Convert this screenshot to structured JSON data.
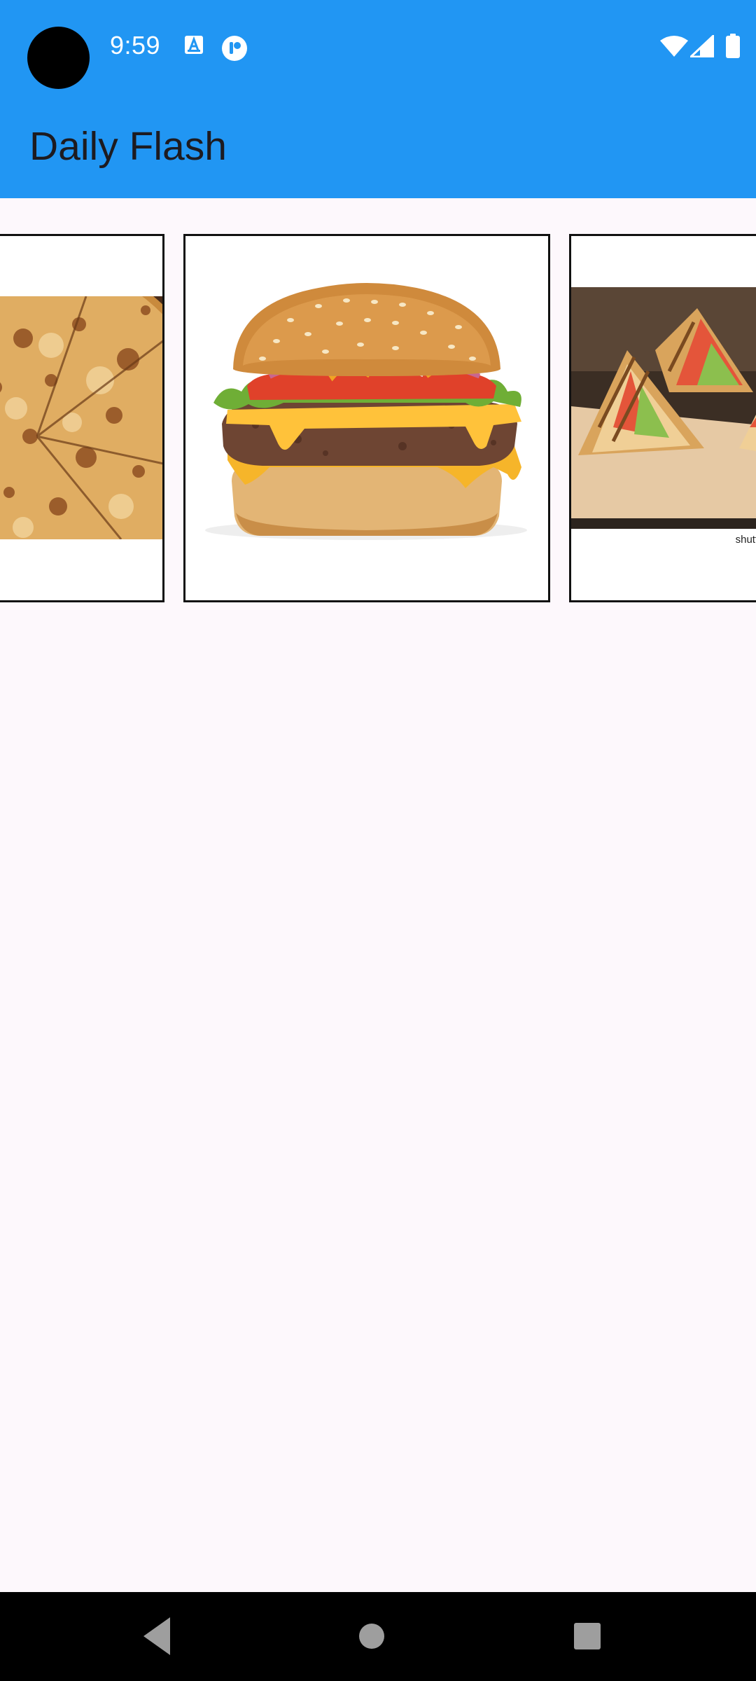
{
  "status_bar": {
    "time": "9:59",
    "icons": [
      "camera-cutout",
      "text-a-notification-icon",
      "app-p-notification-icon",
      "wifi-icon",
      "cellular-signal-icon",
      "battery-icon"
    ]
  },
  "app_bar": {
    "title": "Daily Flash",
    "color": "#2196f3"
  },
  "carousel": {
    "items": [
      {
        "name": "pizza",
        "watermark": ""
      },
      {
        "name": "burger",
        "watermark": ""
      },
      {
        "name": "sandwich",
        "watermark": "shutterstock.com"
      }
    ]
  },
  "nav_bar": {
    "buttons": [
      "back-icon",
      "home-icon",
      "recents-icon"
    ]
  },
  "colors": {
    "background": "#fdf8fc",
    "title_text": "#1d1b20",
    "card_border": "#111111"
  }
}
